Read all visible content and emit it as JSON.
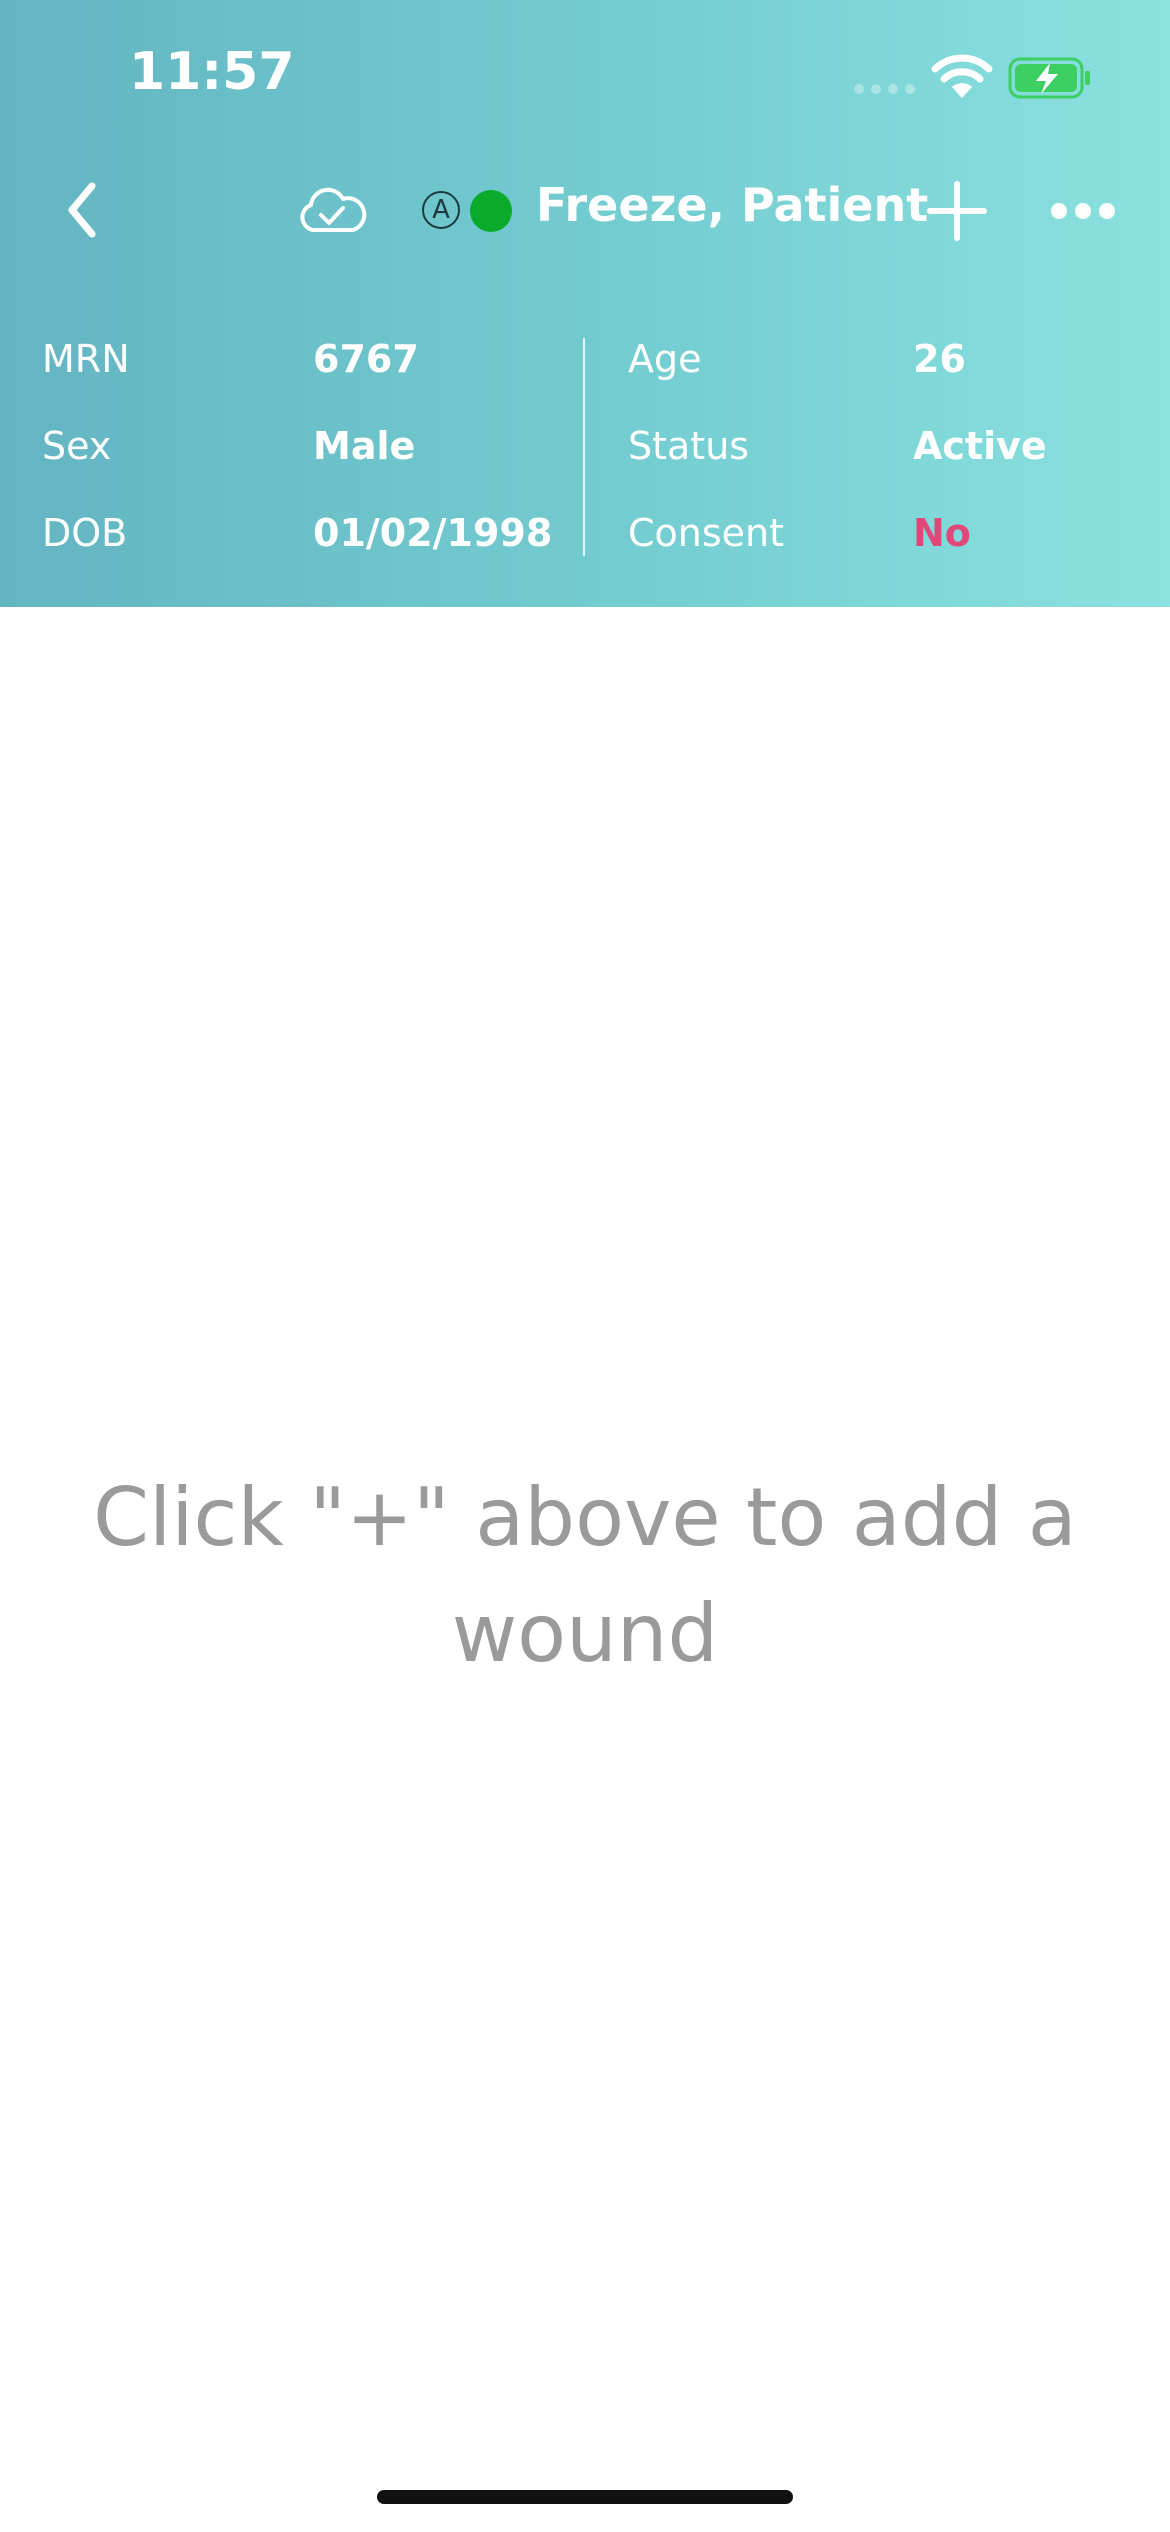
{
  "status_bar": {
    "time": "11:57"
  },
  "nav": {
    "sync_icon": "cloud-check-icon",
    "auto_badge": "A",
    "status_color": "#0aaa2a",
    "patient_name": "Freeze, Patient"
  },
  "patient_info": {
    "left": [
      {
        "label": "MRN",
        "value": "6767"
      },
      {
        "label": "Sex",
        "value": "Male"
      },
      {
        "label": "DOB",
        "value": "01/02/1998"
      }
    ],
    "right": [
      {
        "label": "Age",
        "value": "26"
      },
      {
        "label": "Status",
        "value": "Active"
      },
      {
        "label": "Consent",
        "value": "No"
      }
    ]
  },
  "main": {
    "empty_message": "Click \"+\" above to add a wound"
  },
  "colors": {
    "header_gradient_start": "#63b5c1",
    "header_gradient_end": "#8be1df",
    "alert": "#e2477a",
    "placeholder_text": "#9a9a9a"
  }
}
